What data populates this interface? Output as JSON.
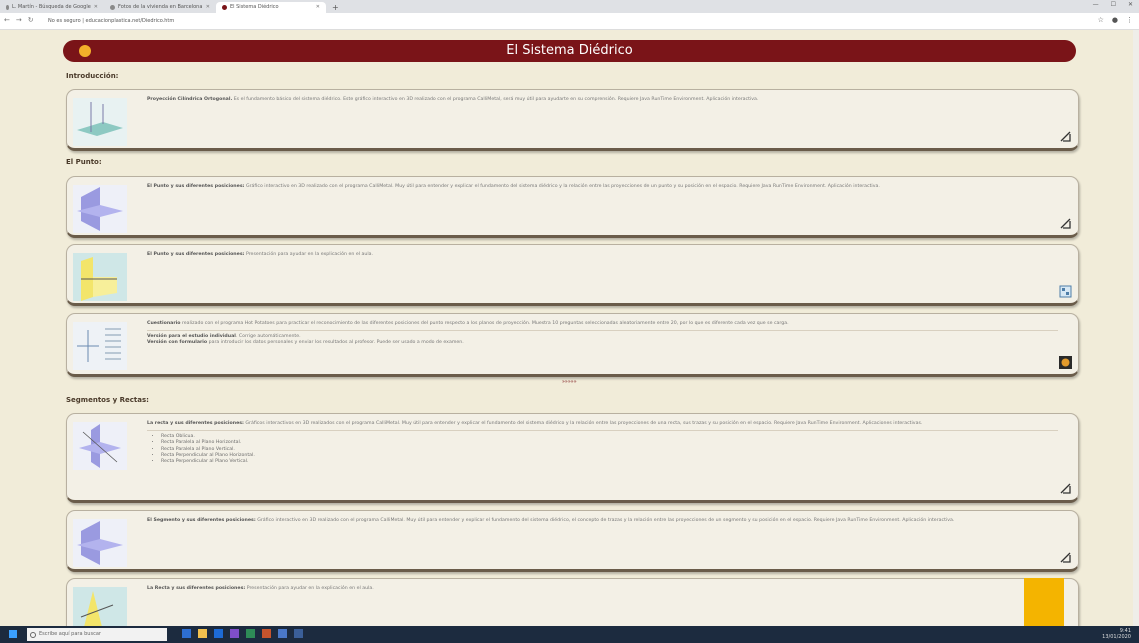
{
  "browser": {
    "tabs": [
      {
        "label": "L. Martín - Búsqueda de Google"
      },
      {
        "label": "Fotos de la vivienda en Barcelona"
      },
      {
        "label": "El Sistema Diédrico",
        "active": true
      }
    ],
    "url": "No es seguro | educacionplastica.net/Diedrico.htm"
  },
  "page": {
    "title": "El Sistema Diédrico",
    "sections": [
      {
        "label": "Introducción:"
      },
      {
        "label": "El Punto:"
      },
      {
        "label": "Segmentos y Rectas:"
      }
    ],
    "cards": [
      {
        "bold": "Proyección Cilíndrica Ortogonal.",
        "text": " Es el fundamento básico del sistema diédrico. Este gráfico interactivo en 3D realizado con el programa CalliMetal, será muy útil para ayudarte en su comprensión. Requiere Java RunTime Environment. Aplicación interactiva.",
        "icon": "java-applet-icon"
      },
      {
        "bold": "El Punto y sus diferentes posiciones:",
        "text": " Gráfico interactivo en 3D realizado con el programa CalliMetal. Muy útil para entender y explicar el fundamento del sistema diédrico y la relación entre las proyecciones de un punto y su posición en el espacio. Requiere Java RunTime Environment. Aplicación interactiva.",
        "icon": "java-applet-icon"
      },
      {
        "bold": "El Punto y sus diferentes posiciones:",
        "text": " Presentación para ayudar en la explicación en el aula.",
        "icon": "presentation-icon"
      },
      {
        "bold": "Cuestionario",
        "text": " realizado con el programa Hot Potatoes para practicar el reconocimiento de las diferentes posiciones del punto respecto a los planos de proyección. Muestra 10 preguntas seleccionadas aleatoriamente entre 20, por lo que es diferente cada vez que se carga.",
        "extra1_bold": "Versión para el estudio individual",
        "extra1": ". Corrige automáticamente.",
        "extra2_bold": "Versión con formulario",
        "extra2": " para introducir los datos personales y enviar los resultados al profesor. Puede ser usado a modo de examen.",
        "icon": "hot-potatoes-icon"
      },
      {
        "bold": "La recta y sus diferentes posiciones:",
        "text": " Gráficos interactivos en 3D realizados con el programa CalliMetal. Muy útil para entender y explicar el fundamento del sistema diédrico y la relación entre las proyecciones de una recta, sus trazas y su posición en el espacio. Requiere Java RunTime Environment. Aplicaciones interactivas.",
        "list": [
          "Recta Oblicua.",
          "Recta Paralela al Plano Horizontal.",
          "Recta Paralela al Plano Vertical.",
          "Recta Perpendicular al Plano Horizontal.",
          "Recta Perpendicular al Plano Vertical."
        ],
        "icon": "java-applet-icon"
      },
      {
        "bold": "El Segmento y sus diferentes posiciones:",
        "text": " Gráfico interactivo en 3D realizado con el programa CalliMetal. Muy útil para entender y explicar el fundamento del sistema diédrico, el concepto de trazas y la relación entre las proyecciones de un segmento y su posición en el espacio. Requiere Java RunTime Environment. Aplicación interactiva.",
        "icon": "java-applet-icon"
      },
      {
        "bold": "La Recta y sus diferentes posiciones:",
        "text": " Presentación para ayudar en la explicación en el aula.",
        "icon": "presentation-icon"
      }
    ],
    "arrows": "»»»»»"
  },
  "taskbar": {
    "search_placeholder": "Escribe aquí para buscar",
    "time": "9:41",
    "date": "13/01/2020"
  },
  "colors": {
    "banner": "#7a1418",
    "background": "#f1ecd9",
    "logo": "#f3b12a"
  }
}
